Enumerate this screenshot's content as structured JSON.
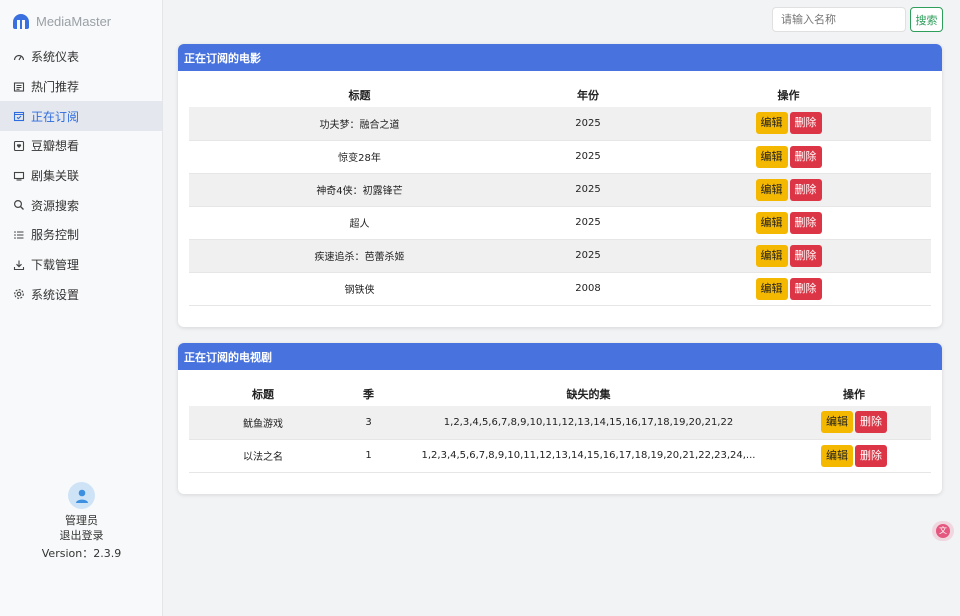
{
  "app": {
    "name": "MediaMaster"
  },
  "sidebar": {
    "items": [
      {
        "label": "系统仪表",
        "icon": "dashboard-icon"
      },
      {
        "label": "热门推荐",
        "icon": "newspaper-icon"
      },
      {
        "label": "正在订阅",
        "icon": "calendar-check-icon",
        "active": true
      },
      {
        "label": "豆瓣想看",
        "icon": "inbox-heart-icon"
      },
      {
        "label": "剧集关联",
        "icon": "tv-icon"
      },
      {
        "label": "资源搜索",
        "icon": "search-icon"
      },
      {
        "label": "服务控制",
        "icon": "list-icon"
      },
      {
        "label": "下载管理",
        "icon": "download-icon"
      },
      {
        "label": "系统设置",
        "icon": "gear-icon"
      }
    ],
    "user": {
      "name": "管理员",
      "logout": "退出登录",
      "version": "Version：2.3.9"
    }
  },
  "search": {
    "placeholder": "请输入名称",
    "button": "搜索"
  },
  "movies": {
    "title": "正在订阅的电影",
    "headers": {
      "title": "标题",
      "year": "年份",
      "actions": "操作"
    },
    "rows": [
      {
        "title": "功夫梦：融合之道",
        "year": "2025"
      },
      {
        "title": "惊变28年",
        "year": "2025"
      },
      {
        "title": "神奇4侠：初露锋芒",
        "year": "2025"
      },
      {
        "title": "超人",
        "year": "2025"
      },
      {
        "title": "疾速追杀：芭蕾杀姬",
        "year": "2025"
      },
      {
        "title": "钢铁侠",
        "year": "2008"
      }
    ]
  },
  "tv": {
    "title": "正在订阅的电视剧",
    "headers": {
      "title": "标题",
      "season": "季",
      "missing": "缺失的集",
      "actions": "操作"
    },
    "rows": [
      {
        "title": "鱿鱼游戏",
        "season": "3",
        "missing": "1,2,3,4,5,6,7,8,9,10,11,12,13,14,15,16,17,18,19,20,21,22"
      },
      {
        "title": "以法之名",
        "season": "1",
        "missing": "1,2,3,4,5,6,7,8,9,10,11,12,13,14,15,16,17,18,19,20,21,22,23,24,..."
      }
    ]
  },
  "actions": {
    "edit": "编辑",
    "delete": "删除"
  },
  "colors": {
    "accent": "#4872de",
    "edit": "#f5b800",
    "delete": "#dc3545",
    "search": "#2e9e5b"
  }
}
